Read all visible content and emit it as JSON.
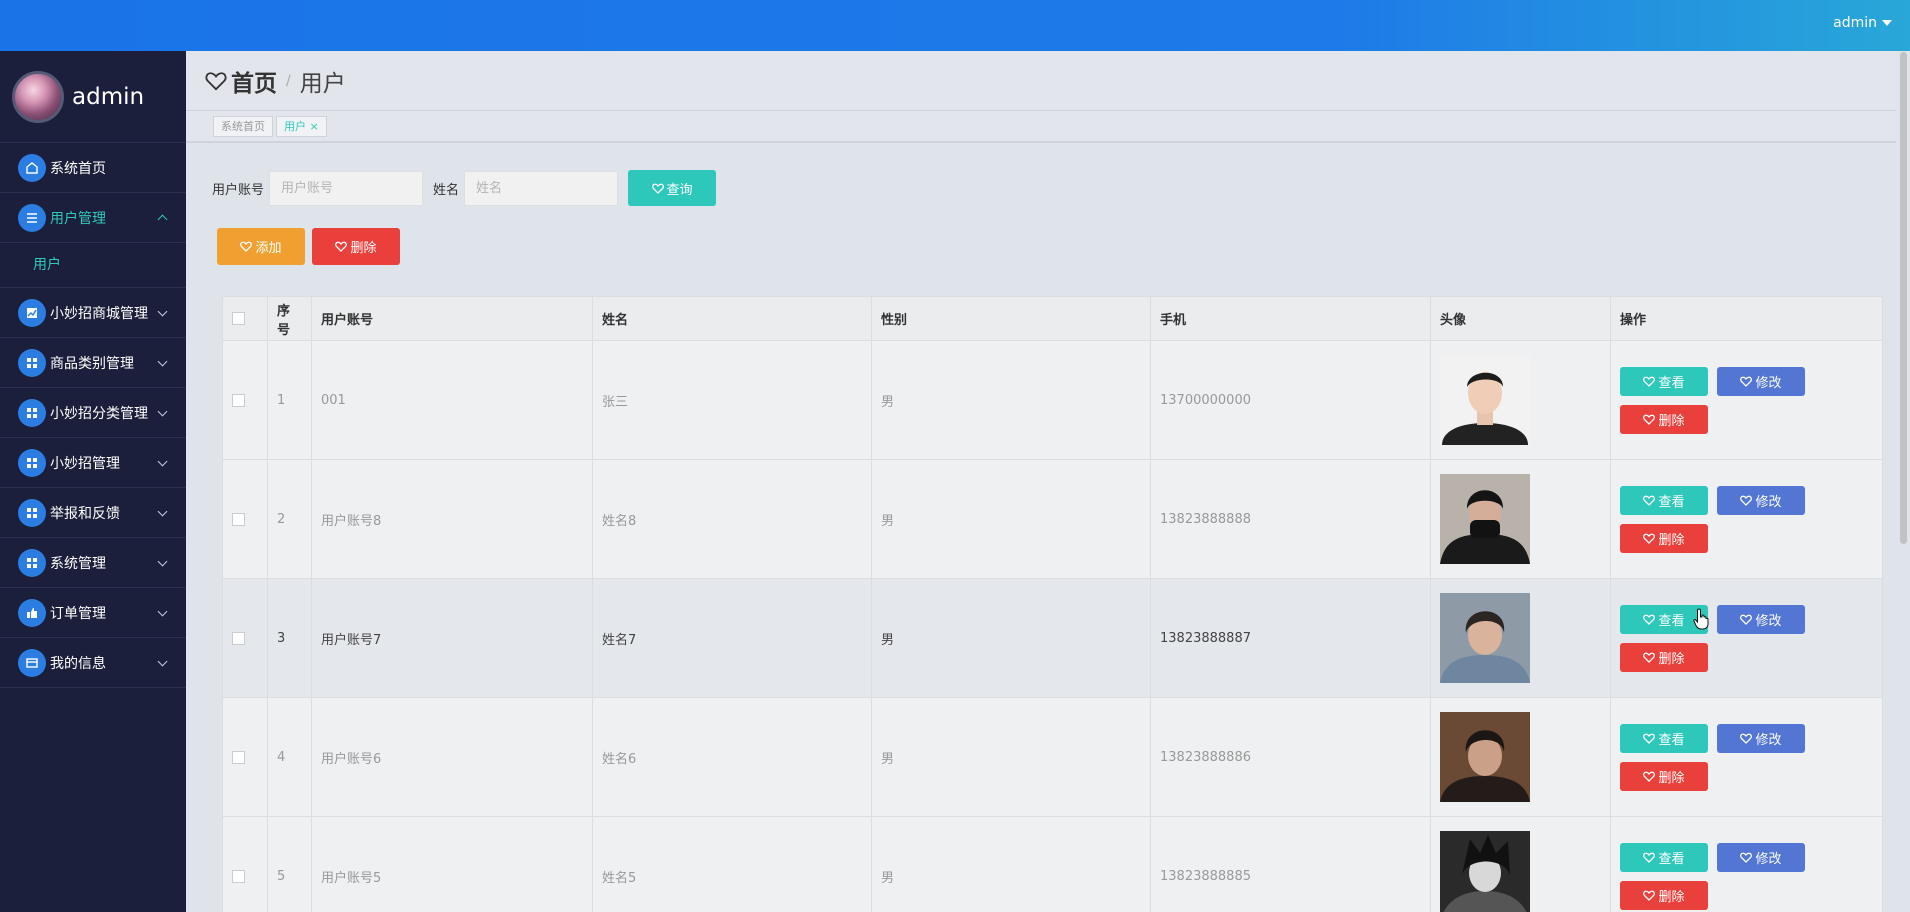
{
  "header": {
    "user": "admin"
  },
  "sidebar": {
    "profile_name": "admin",
    "menu": [
      {
        "label": "系统首页",
        "icon": "home-icon",
        "active": false,
        "expandable": false
      },
      {
        "label": "用户管理",
        "icon": "list-icon",
        "active": true,
        "expandable": true,
        "expanded": true
      },
      {
        "label": "小妙招商城管理",
        "icon": "chart-icon",
        "active": false,
        "expandable": true
      },
      {
        "label": "商品类别管理",
        "icon": "grid-icon",
        "active": false,
        "expandable": true
      },
      {
        "label": "小妙招分类管理",
        "icon": "grid-icon",
        "active": false,
        "expandable": true
      },
      {
        "label": "小妙招管理",
        "icon": "grid-icon",
        "active": false,
        "expandable": true
      },
      {
        "label": "举报和反馈",
        "icon": "grid-icon",
        "active": false,
        "expandable": true
      },
      {
        "label": "系统管理",
        "icon": "grid-icon",
        "active": false,
        "expandable": true
      },
      {
        "label": "订单管理",
        "icon": "thumb-icon",
        "active": false,
        "expandable": true
      },
      {
        "label": "我的信息",
        "icon": "card-icon",
        "active": false,
        "expandable": true
      }
    ],
    "submenu": [
      {
        "label": "用户"
      }
    ]
  },
  "breadcrumb": {
    "home": "首页",
    "separator": "/",
    "current": "用户"
  },
  "tabs": [
    {
      "label": "系统首页",
      "active": false
    },
    {
      "label": "用户",
      "active": true
    }
  ],
  "search": {
    "account_label": "用户账号",
    "account_placeholder": "用户账号",
    "name_label": "姓名",
    "name_placeholder": "姓名",
    "query_button": "查询"
  },
  "actions": {
    "add": "添加",
    "delete": "删除"
  },
  "table": {
    "columns": [
      "序号",
      "用户账号",
      "姓名",
      "性别",
      "手机",
      "头像",
      "操作"
    ],
    "rows": [
      {
        "no": "1",
        "account": "001",
        "name": "张三",
        "gender": "男",
        "phone": "13700000000"
      },
      {
        "no": "2",
        "account": "用户账号8",
        "name": "姓名8",
        "gender": "男",
        "phone": "13823888888"
      },
      {
        "no": "3",
        "account": "用户账号7",
        "name": "姓名7",
        "gender": "男",
        "phone": "13823888887"
      },
      {
        "no": "4",
        "account": "用户账号6",
        "name": "姓名6",
        "gender": "男",
        "phone": "13823888886"
      },
      {
        "no": "5",
        "account": "用户账号5",
        "name": "姓名5",
        "gender": "男",
        "phone": "13823888885"
      }
    ],
    "row_buttons": {
      "view": "查看",
      "edit": "修改",
      "delete": "删除"
    }
  },
  "colors": {
    "topbar": "#1a74e8",
    "sidebar": "#1b1f3b",
    "accent": "#2ec8bb",
    "edit": "#5376d4",
    "danger": "#e9403c",
    "warn": "#f0a030"
  }
}
